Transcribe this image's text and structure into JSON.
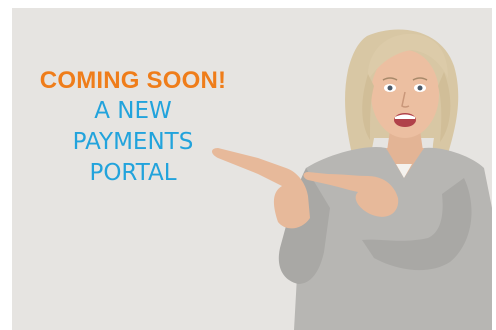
{
  "banner": {
    "headline": "COMING SOON!",
    "subline_1": "A NEW",
    "subline_2": "PAYMENTS",
    "subline_3": "PORTAL"
  },
  "colors": {
    "background": "#e6e4e1",
    "headline": "#ef7d1a",
    "subline": "#22a3dc"
  },
  "photo": {
    "subject": "smiling woman pointing-left"
  }
}
